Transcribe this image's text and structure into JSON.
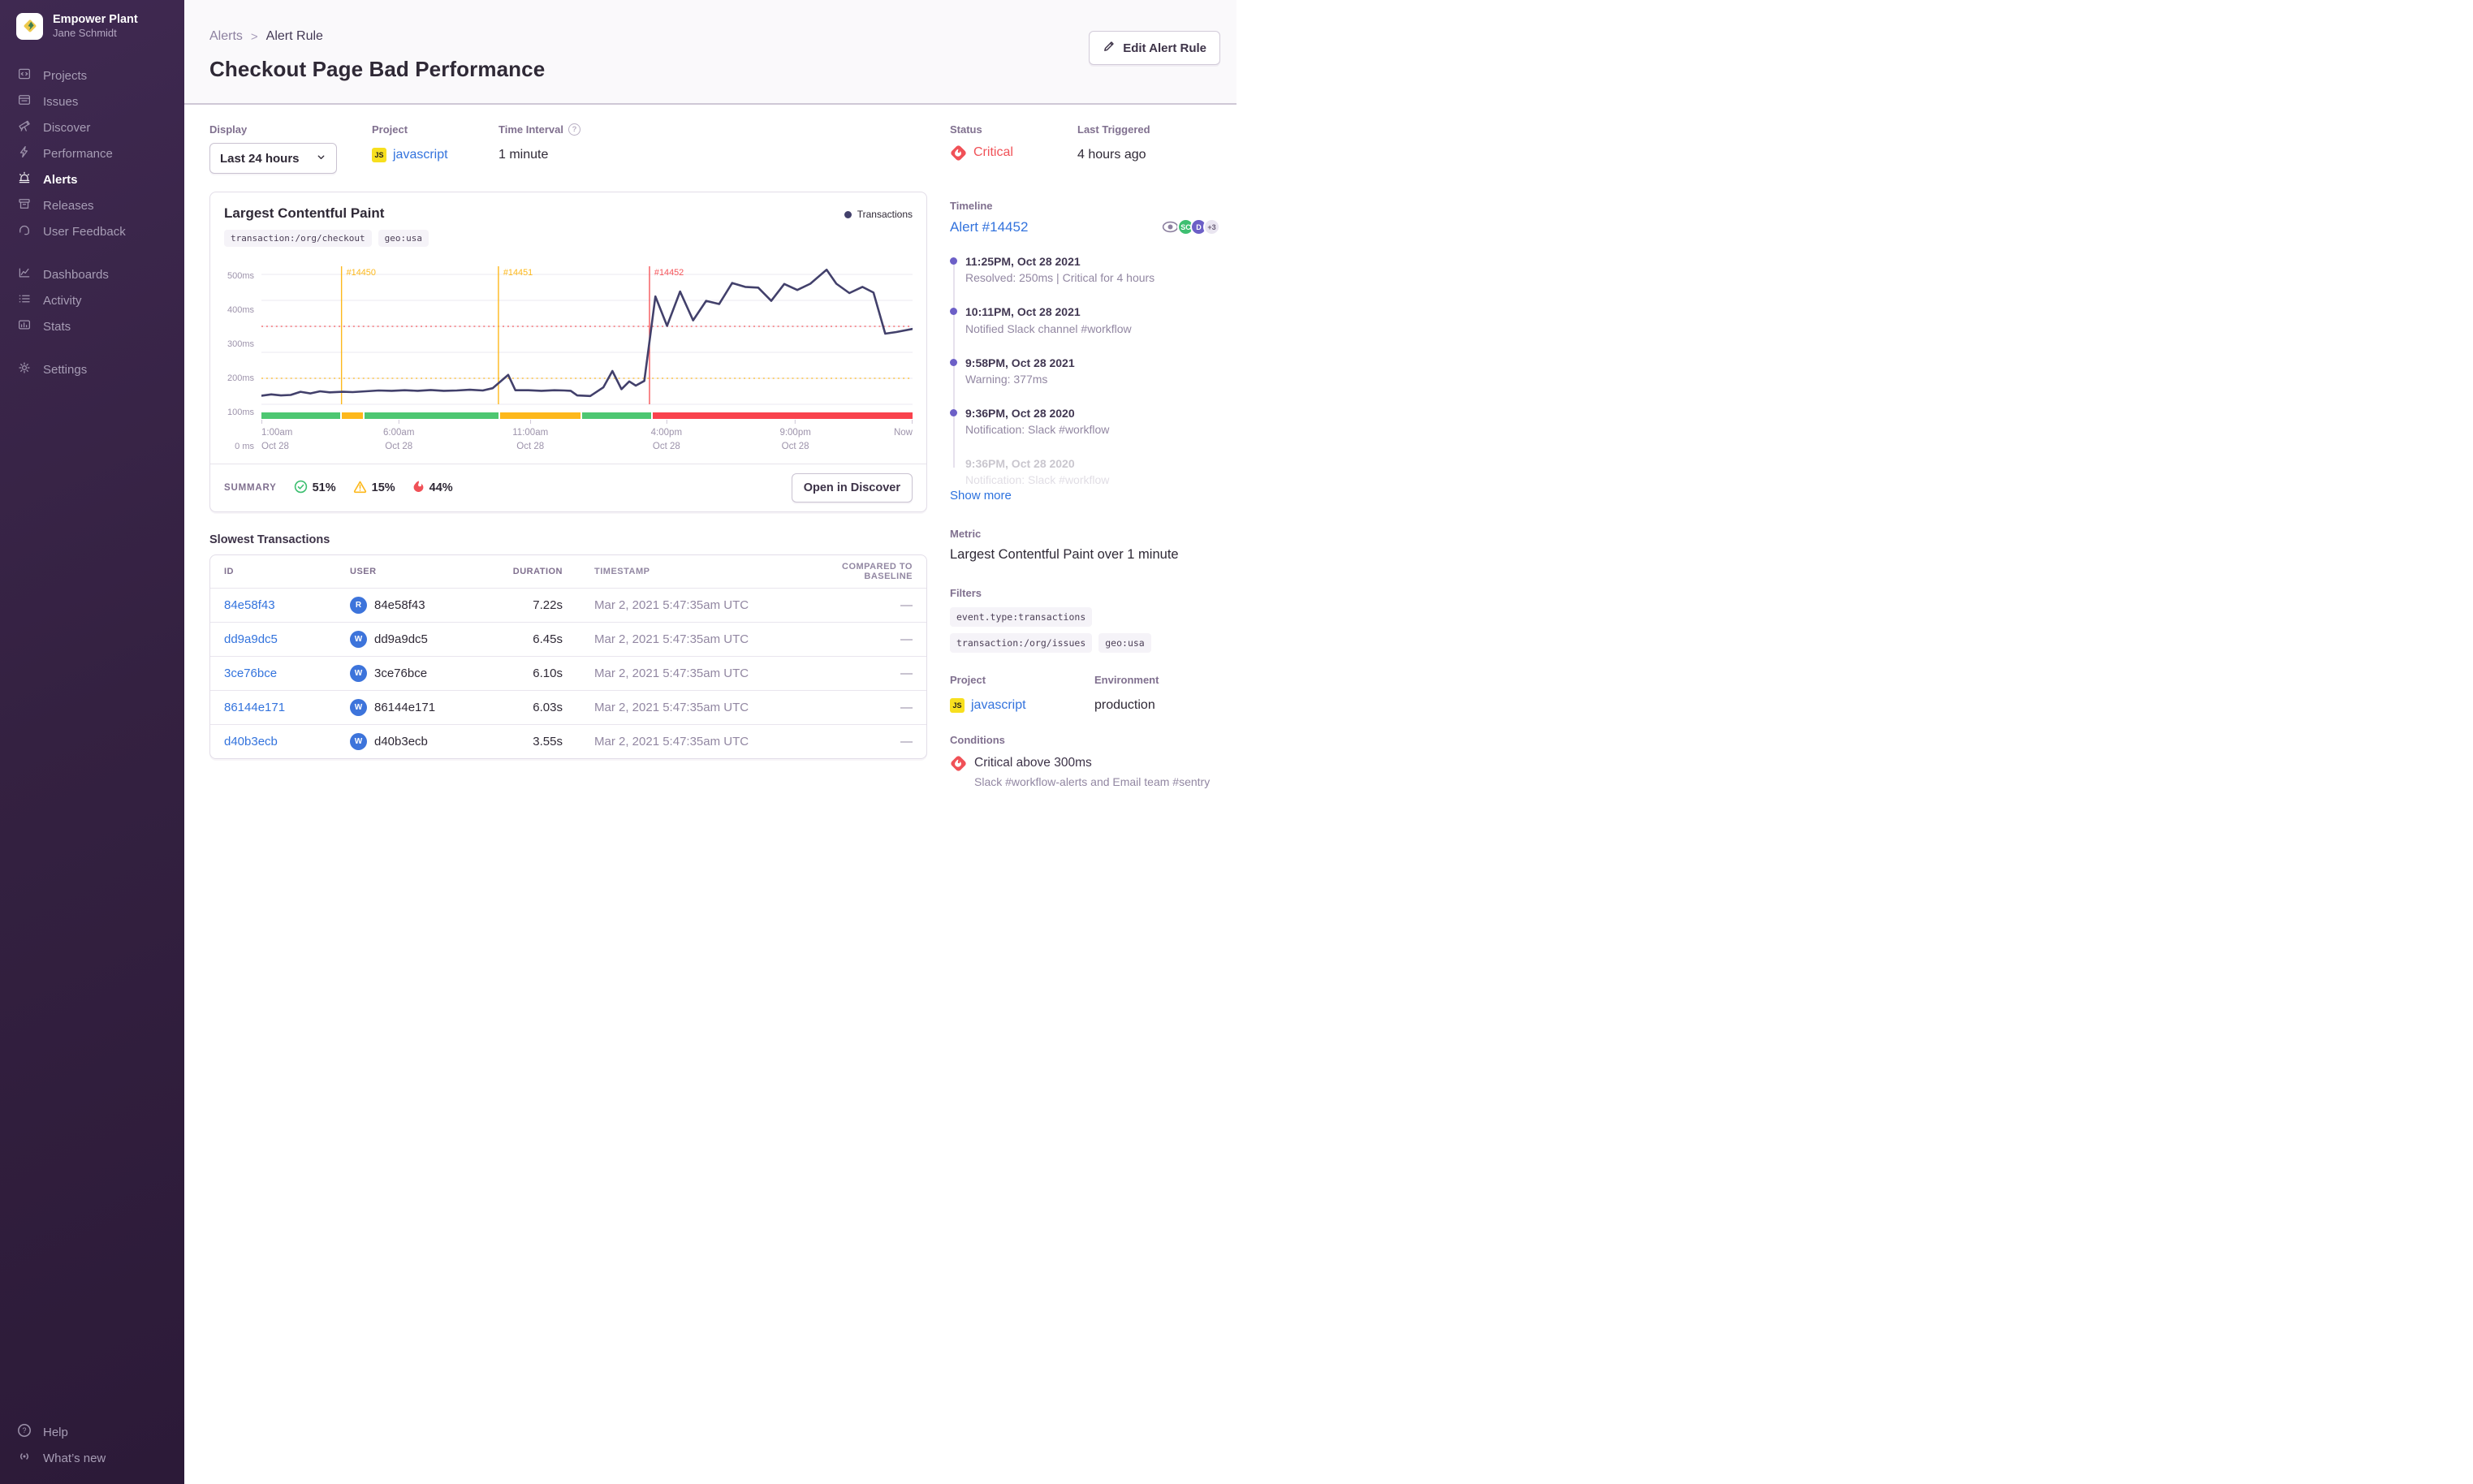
{
  "sidebar": {
    "org_name": "Empower Plant",
    "user_name": "Jane Schmidt",
    "groups": [
      {
        "items": [
          {
            "label": "Projects"
          },
          {
            "label": "Issues"
          },
          {
            "label": "Discover"
          },
          {
            "label": "Performance"
          },
          {
            "label": "Alerts"
          },
          {
            "label": "Releases"
          },
          {
            "label": "User Feedback"
          }
        ]
      },
      {
        "items": [
          {
            "label": "Dashboards"
          },
          {
            "label": "Activity"
          },
          {
            "label": "Stats"
          }
        ]
      },
      {
        "items": [
          {
            "label": "Settings"
          }
        ]
      },
      {
        "items": [
          {
            "label": "Help"
          },
          {
            "label": "What’s new"
          }
        ]
      }
    ]
  },
  "header": {
    "breadcrumb": {
      "parent": "Alerts",
      "current": "Alert Rule"
    },
    "title": "Checkout Page Bad Performance",
    "edit_button": "Edit Alert Rule"
  },
  "filter_bar": {
    "display": {
      "label": "Display",
      "value": "Last 24 hours"
    },
    "project": {
      "label": "Project",
      "value": "javascript"
    },
    "time_interval": {
      "label": "Time Interval",
      "value": "1 minute"
    }
  },
  "status_panel": {
    "status": {
      "label": "Status",
      "value": "Critical"
    },
    "last_triggered": {
      "label": "Last Triggered",
      "value": "4 hours ago"
    }
  },
  "chart_card": {
    "title": "Largest Contentful Paint",
    "tags": [
      "transaction:/org/checkout",
      "geo:usa"
    ],
    "legend": "Transactions",
    "summary": {
      "label": "SUMMARY",
      "stats": [
        {
          "icon": "check-circle",
          "color": "#3ebf71",
          "value": "51%"
        },
        {
          "icon": "warning-triangle",
          "color": "#fdb81b",
          "value": "15%"
        },
        {
          "icon": "fire",
          "color": "#f05157",
          "value": "44%"
        }
      ],
      "button": "Open in Discover"
    }
  },
  "chart_data": {
    "type": "line",
    "title": "Largest Contentful Paint",
    "unit": "ms",
    "ylim": [
      0,
      500
    ],
    "grid": true,
    "legend_position": "top-right",
    "y_ticks": [
      "500ms",
      "400ms",
      "300ms",
      "200ms",
      "100ms",
      "0 ms"
    ],
    "x_ticks": [
      {
        "label": "1:00am",
        "sublabel": "Oct 28",
        "pos": 0
      },
      {
        "label": "6:00am",
        "sublabel": "Oct 28",
        "pos": 21.1
      },
      {
        "label": "11:00am",
        "sublabel": "Oct 28",
        "pos": 41.3
      },
      {
        "label": "4:00pm",
        "sublabel": "Oct 28",
        "pos": 62.2
      },
      {
        "label": "9:00pm",
        "sublabel": "Oct 28",
        "pos": 82
      },
      {
        "label": "Now",
        "sublabel": "",
        "pos": 100
      }
    ],
    "thresholds": [
      {
        "label": "critical",
        "value": 300,
        "color": "#f55459"
      },
      {
        "label": "warning",
        "value": 100,
        "color": "#fdb81b"
      }
    ],
    "incidents": [
      {
        "id": "#14450",
        "pos": 12.3,
        "color": "#fdb81b"
      },
      {
        "id": "#14451",
        "pos": 36.4,
        "color": "#fdb81b"
      },
      {
        "id": "#14452",
        "pos": 59.6,
        "color": "#f55459"
      }
    ],
    "status_bar": [
      {
        "color": "#4dc771",
        "width": 12.3
      },
      {
        "color": "#fdb81b",
        "width": 3.2
      },
      {
        "color": "#4dc771",
        "width": 20.9
      },
      {
        "color": "#fdb81b",
        "width": 12.5
      },
      {
        "color": "#4dc771",
        "width": 10.7
      },
      {
        "color": "#f9424d",
        "width": 40.4
      }
    ],
    "series": [
      {
        "name": "Transactions",
        "color": "#42406b",
        "points": [
          [
            0,
            33
          ],
          [
            1.5,
            38
          ],
          [
            3,
            34
          ],
          [
            4.5,
            36
          ],
          [
            6,
            48
          ],
          [
            7.5,
            42
          ],
          [
            9,
            50
          ],
          [
            10.5,
            46
          ],
          [
            12.5,
            48
          ],
          [
            14,
            47
          ],
          [
            16,
            50
          ],
          [
            18,
            53
          ],
          [
            20,
            52
          ],
          [
            22,
            54
          ],
          [
            24,
            52
          ],
          [
            26,
            55
          ],
          [
            28,
            52
          ],
          [
            30,
            53
          ],
          [
            32,
            56
          ],
          [
            34,
            53
          ],
          [
            35.5,
            62
          ],
          [
            37.9,
            113
          ],
          [
            39,
            54
          ],
          [
            41,
            54
          ],
          [
            43,
            52
          ],
          [
            45,
            54
          ],
          [
            46.5,
            53
          ],
          [
            47.5,
            52
          ],
          [
            48.5,
            34
          ],
          [
            50.5,
            32
          ],
          [
            52.5,
            65
          ],
          [
            53.9,
            128
          ],
          [
            55.3,
            58
          ],
          [
            56.5,
            88
          ],
          [
            57.5,
            72
          ],
          [
            58.8,
            90
          ],
          [
            60.5,
            415
          ],
          [
            62.3,
            302
          ],
          [
            64.3,
            434
          ],
          [
            66.3,
            323
          ],
          [
            68.3,
            398
          ],
          [
            70.3,
            386
          ],
          [
            72.3,
            467
          ],
          [
            74.3,
            452
          ],
          [
            76.3,
            449
          ],
          [
            78.3,
            398
          ],
          [
            80.3,
            463
          ],
          [
            82.3,
            440
          ],
          [
            84.3,
            464
          ],
          [
            86.8,
            518
          ],
          [
            88.3,
            464
          ],
          [
            90.3,
            428
          ],
          [
            92.3,
            452
          ],
          [
            94,
            430
          ],
          [
            95.8,
            272
          ],
          [
            97.5,
            278
          ],
          [
            100,
            290
          ]
        ]
      }
    ]
  },
  "transactions": {
    "heading": "Slowest Transactions",
    "columns": [
      "ID",
      "USER",
      "DURATION",
      "TIMESTAMP",
      "COMPARED TO BASELINE"
    ],
    "rows": [
      {
        "id": "84e58f43",
        "user_initial": "R",
        "user": "84e58f43",
        "duration": "7.22s",
        "timestamp": "Mar 2, 2021 5:47:35am UTC",
        "baseline": "—"
      },
      {
        "id": "dd9a9dc5",
        "user_initial": "W",
        "user": "dd9a9dc5",
        "duration": "6.45s",
        "timestamp": "Mar 2, 2021 5:47:35am UTC",
        "baseline": "—"
      },
      {
        "id": "3ce76bce",
        "user_initial": "W",
        "user": "3ce76bce",
        "duration": "6.10s",
        "timestamp": "Mar 2, 2021 5:47:35am UTC",
        "baseline": "—"
      },
      {
        "id": "86144e171",
        "user_initial": "W",
        "user": "86144e171",
        "duration": "6.03s",
        "timestamp": "Mar 2, 2021 5:47:35am UTC",
        "baseline": "—"
      },
      {
        "id": "d40b3ecb",
        "user_initial": "W",
        "user": "d40b3ecb",
        "duration": "3.55s",
        "timestamp": "Mar 2, 2021 5:47:35am UTC",
        "baseline": "—"
      }
    ]
  },
  "timeline": {
    "label": "Timeline",
    "alert_link": "Alert #14452",
    "avatars": [
      {
        "text": "SC",
        "color": "#3ebf71"
      },
      {
        "text": "D",
        "color": "#6c5fc7"
      },
      {
        "text": "+3",
        "color": "#e9e5f0"
      }
    ],
    "events": [
      {
        "time": "11:25PM, Oct 28 2021",
        "desc": "Resolved: 250ms | Critical for 4 hours"
      },
      {
        "time": "10:11PM, Oct 28 2021",
        "desc": "Notified Slack channel #workflow"
      },
      {
        "time": "9:58PM, Oct 28 2021",
        "desc": "Warning: 377ms"
      },
      {
        "time": "9:36PM, Oct 28 2020",
        "desc": "Notification: Slack #workflow"
      }
    ],
    "faded_event": {
      "time": "9:36PM, Oct 28 2020",
      "desc": "Notification: Slack #workflow"
    },
    "show_more": "Show more"
  },
  "details": {
    "metric": {
      "label": "Metric",
      "value": "Largest Contentful Paint over 1 minute"
    },
    "filters": {
      "label": "Filters",
      "tags": [
        "event.type:transactions",
        "transaction:/org/issues",
        "geo:usa"
      ]
    },
    "project": {
      "label": "Project",
      "value": "javascript"
    },
    "environment": {
      "label": "Environment",
      "value": "production"
    },
    "conditions": {
      "label": "Conditions",
      "title": "Critical above 300ms",
      "subtitle": "Slack #workflow-alerts and Email team #sentry"
    }
  }
}
